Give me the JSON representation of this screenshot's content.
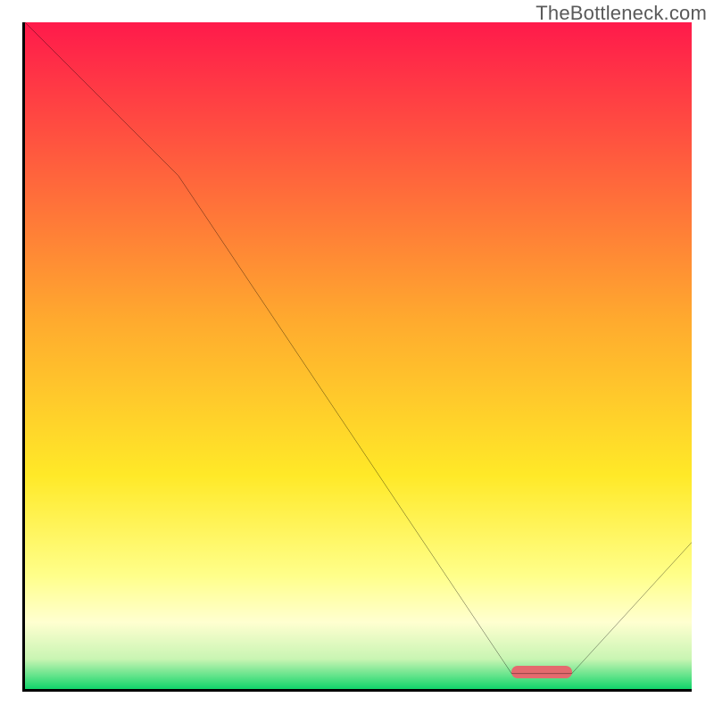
{
  "watermark": "TheBottleneck.com",
  "chart_data": {
    "type": "line",
    "title": "",
    "xlabel": "",
    "ylabel": "",
    "xlim": [
      0,
      100
    ],
    "ylim": [
      0,
      100
    ],
    "series": [
      {
        "name": "curve",
        "x": [
          0,
          23,
          73,
          82,
          100
        ],
        "values": [
          100,
          77,
          2.3,
          2.3,
          22
        ]
      }
    ],
    "indicator": {
      "x_start": 73,
      "x_end": 82,
      "y": 2.5
    },
    "gradient_stops": [
      {
        "pos": 0.0,
        "color": "#ff1a4b"
      },
      {
        "pos": 0.45,
        "color": "#ffab2e"
      },
      {
        "pos": 0.68,
        "color": "#ffe928"
      },
      {
        "pos": 0.83,
        "color": "#ffff8a"
      },
      {
        "pos": 0.9,
        "color": "#ffffd0"
      },
      {
        "pos": 0.955,
        "color": "#c9f5b3"
      },
      {
        "pos": 1.0,
        "color": "#11d56a"
      }
    ]
  }
}
